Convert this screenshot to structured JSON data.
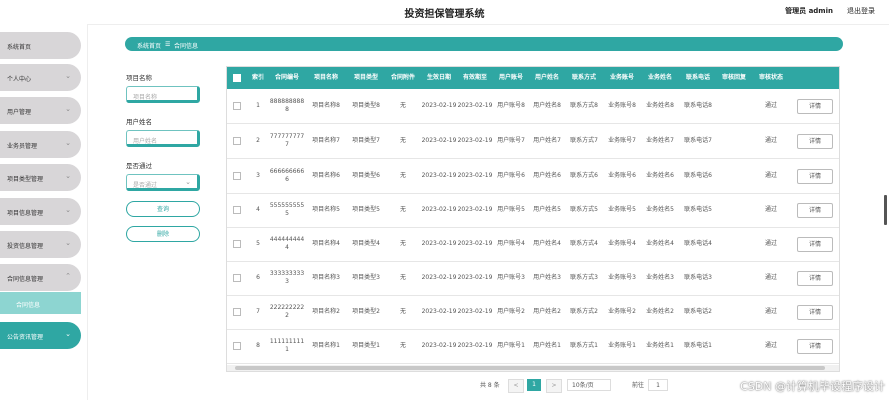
{
  "header": {
    "title": "投资担保管理系统",
    "admin": "管理员 admin",
    "logout": "退出登录"
  },
  "sidebar": {
    "items": [
      {
        "label": "系统首页"
      },
      {
        "label": "个人中心",
        "chev": "⌄"
      },
      {
        "label": "用户管理",
        "chev": "⌄"
      },
      {
        "label": "业务员管理",
        "chev": "⌄"
      },
      {
        "label": "项目类型管理",
        "chev": "⌄"
      },
      {
        "label": "项目信息管理",
        "chev": "⌄"
      },
      {
        "label": "投资信息管理",
        "chev": "⌄"
      },
      {
        "label": "合同信息管理",
        "chev": "⌃"
      },
      {
        "label": "公告资讯管理",
        "chev": "⌄"
      }
    ],
    "sub": "合同信息"
  },
  "breadcrumb": {
    "home": "系统首页",
    "sep": "☰",
    "current": "合同信息"
  },
  "filters": {
    "project_label": "项目名称",
    "project_placeholder": "项目名称",
    "user_label": "用户姓名",
    "user_placeholder": "用户姓名",
    "pass_label": "是否通过",
    "pass_placeholder": "是否通过",
    "query": "查询",
    "delete": "删除"
  },
  "table": {
    "headers": [
      "索引",
      "合同编号",
      "项目名称",
      "项目类型",
      "合同附件",
      "生效日期",
      "有效期至",
      "用户账号",
      "用户姓名",
      "联系方式",
      "业务账号",
      "业务姓名",
      "联系电话",
      "审核回复",
      "审核状态"
    ],
    "detail": "详情",
    "rows": [
      [
        "1",
        "8888888888",
        "项目名称8",
        "项目类型8",
        "无",
        "2023-02-19",
        "2023-02-19",
        "用户账号8",
        "用户姓名8",
        "联系方式8",
        "业务账号8",
        "业务姓名8",
        "联系电话8",
        "",
        "通过"
      ],
      [
        "2",
        "7777777777",
        "项目名称7",
        "项目类型7",
        "无",
        "2023-02-19",
        "2023-02-19",
        "用户账号7",
        "用户姓名7",
        "联系方式7",
        "业务账号7",
        "业务姓名7",
        "联系电话7",
        "",
        "通过"
      ],
      [
        "3",
        "6666666666",
        "项目名称6",
        "项目类型6",
        "无",
        "2023-02-19",
        "2023-02-19",
        "用户账号6",
        "用户姓名6",
        "联系方式6",
        "业务账号6",
        "业务姓名6",
        "联系电话6",
        "",
        "通过"
      ],
      [
        "4",
        "5555555555",
        "项目名称5",
        "项目类型5",
        "无",
        "2023-02-19",
        "2023-02-19",
        "用户账号5",
        "用户姓名5",
        "联系方式5",
        "业务账号5",
        "业务姓名5",
        "联系电话5",
        "",
        "通过"
      ],
      [
        "5",
        "4444444444",
        "项目名称4",
        "项目类型4",
        "无",
        "2023-02-19",
        "2023-02-19",
        "用户账号4",
        "用户姓名4",
        "联系方式4",
        "业务账号4",
        "业务姓名4",
        "联系电话4",
        "",
        "通过"
      ],
      [
        "6",
        "3333333333",
        "项目名称3",
        "项目类型3",
        "无",
        "2023-02-19",
        "2023-02-19",
        "用户账号3",
        "用户姓名3",
        "联系方式3",
        "业务账号3",
        "业务姓名3",
        "联系电话3",
        "",
        "通过"
      ],
      [
        "7",
        "2222222222",
        "项目名称2",
        "项目类型2",
        "无",
        "2023-02-19",
        "2023-02-19",
        "用户账号2",
        "用户姓名2",
        "联系方式2",
        "业务账号2",
        "业务姓名2",
        "联系电话2",
        "",
        "通过"
      ],
      [
        "8",
        "1111111111",
        "项目名称1",
        "项目类型1",
        "无",
        "2023-02-19",
        "2023-02-19",
        "用户账号1",
        "用户姓名1",
        "联系方式1",
        "业务账号1",
        "业务姓名1",
        "联系电话1",
        "",
        "通过"
      ]
    ]
  },
  "pager": {
    "total": "共 8 条",
    "prev": "<",
    "page": "1",
    "next": ">",
    "size": "10条/页",
    "goto": "前往",
    "goto_value": "1"
  },
  "watermark": "CSDN @计算机毕设程序设计"
}
